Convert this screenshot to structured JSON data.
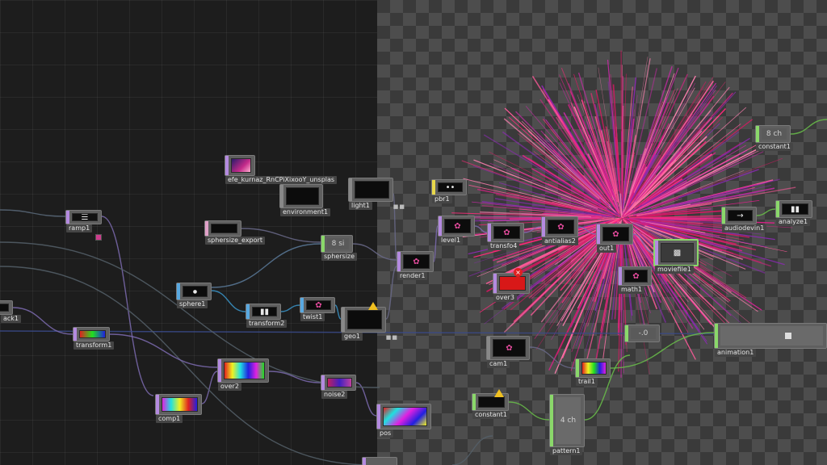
{
  "colors": {
    "top": "#b48ae0",
    "comp": "#9c7ad0",
    "sop": "#58a8e0",
    "mat": "#e8d84a",
    "chop": "#8ad86a",
    "dat": "#e0a0c8",
    "wire_top": "#7d6bb0",
    "wire_sop": "#3a94c8",
    "wire_chop": "#6ac04a"
  },
  "nodes": {
    "ramp1": "ramp1",
    "unsplash": "efe_kurnaz_RnCPiXixooY_unsplas",
    "environment1": "environment1",
    "light1": "light1",
    "phr1": "pbr1",
    "sphersize_export": "sphersize_export",
    "sphersize": "sphersize",
    "sphersize_chan": "8 si",
    "sphere1": "sphere1",
    "transform2": "transform2",
    "twist1": "twist1",
    "geo1": "geo1",
    "render1": "render1",
    "level1": "level1",
    "transform_b": "transfo4",
    "antialias2": "antialias2",
    "out1": "out1",
    "movieout": "moviefile1",
    "over3": "over3",
    "analyze1": "analyze1",
    "audio": "audiodevin1",
    "constant1": "constant1",
    "constant1_chan": "8 ch",
    "math1": "math1",
    "cam1": "cam1",
    "null1_value": "-.0",
    "animation1": "animation1",
    "trail1": "trail1",
    "constant2": "constant1",
    "pattern1": "pattern1",
    "pattern1_chan": "4 ch",
    "over2": "over2",
    "noise2": "noise2",
    "pos": "pos",
    "comp1": "comp1",
    "transform1": "transform1",
    "track1": "ack1"
  },
  "icons": {
    "warning": "warning-icon",
    "error": "error-icon",
    "arrow": "→"
  }
}
